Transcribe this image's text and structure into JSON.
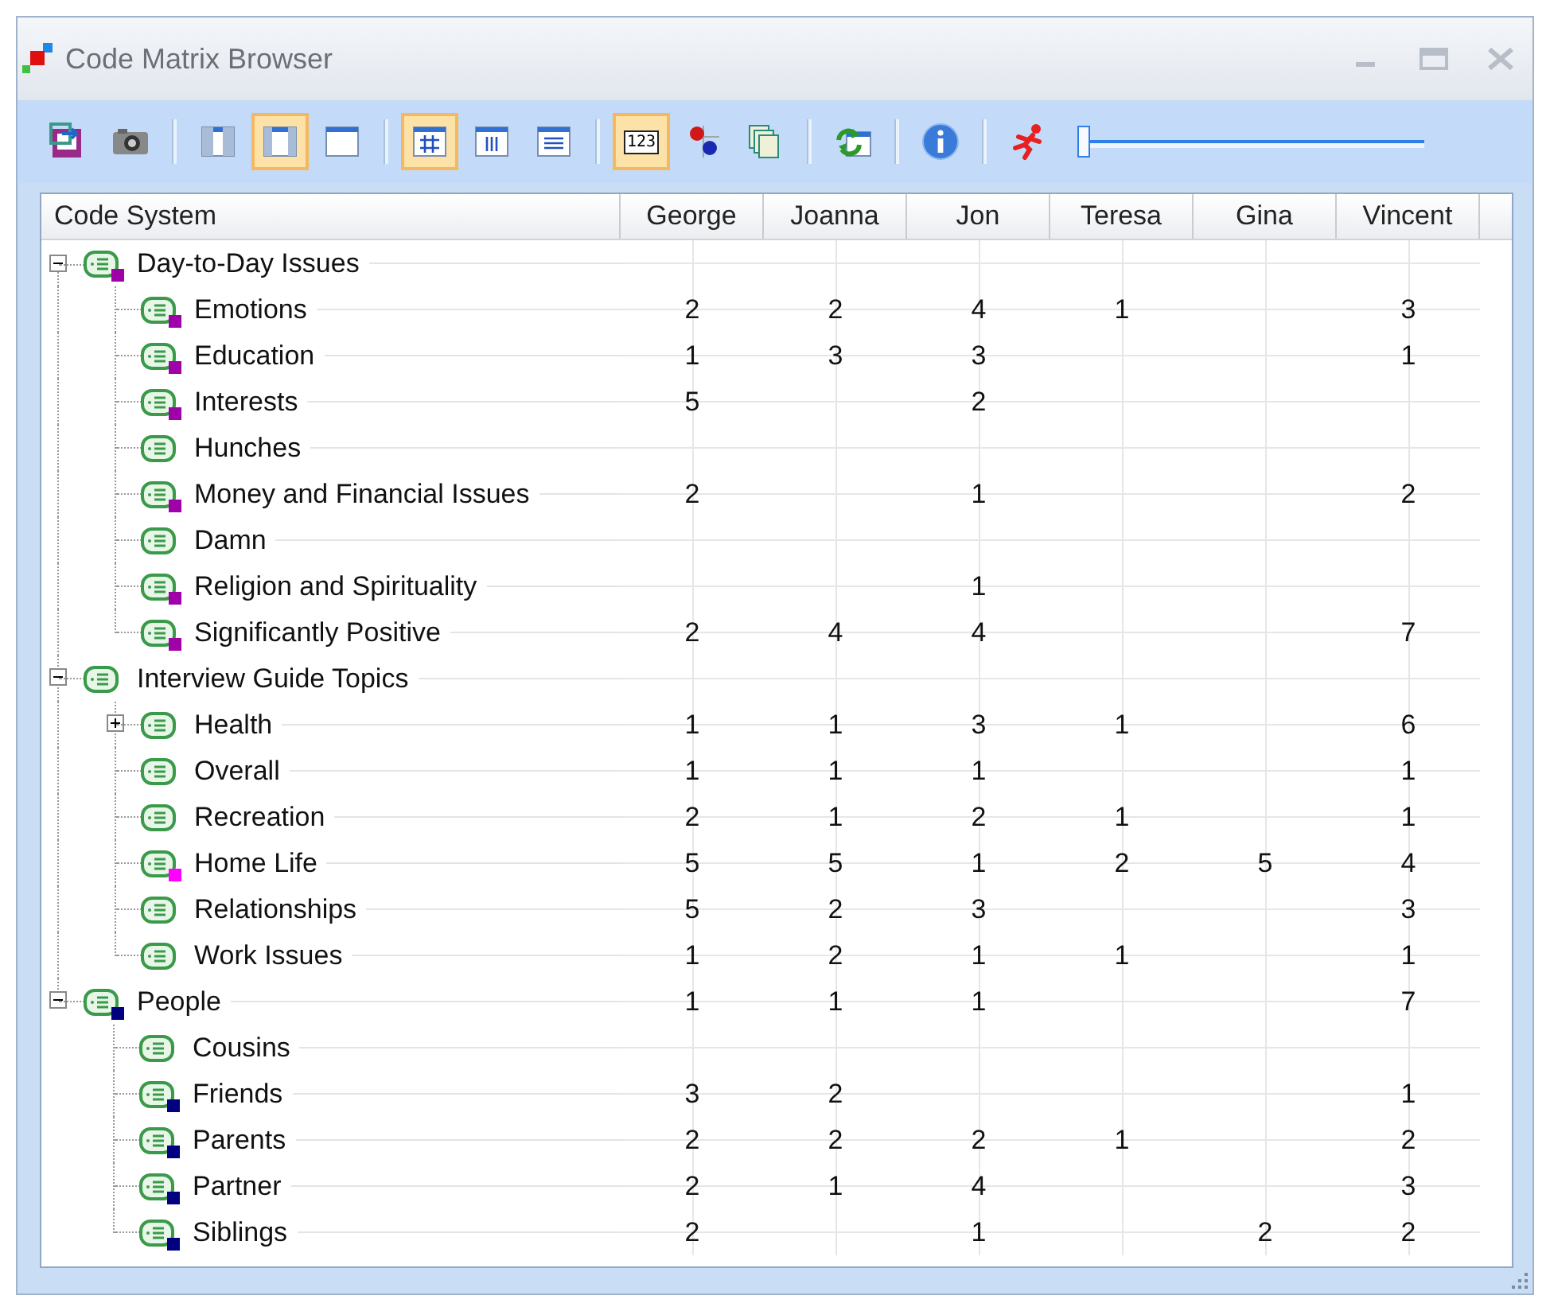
{
  "window": {
    "title": "Code Matrix Browser"
  },
  "toolbar": [
    {
      "kind": "export",
      "selected": false
    },
    {
      "kind": "camera",
      "selected": false
    },
    {
      "kind": "sep"
    },
    {
      "kind": "layout-left",
      "selected": false
    },
    {
      "kind": "layout-mid",
      "selected": true
    },
    {
      "kind": "layout-full",
      "selected": false
    },
    {
      "kind": "sep"
    },
    {
      "kind": "grid",
      "selected": true
    },
    {
      "kind": "cols",
      "selected": false
    },
    {
      "kind": "rows",
      "selected": false
    },
    {
      "kind": "sep"
    },
    {
      "kind": "numbers",
      "selected": true,
      "label": "123"
    },
    {
      "kind": "nodes",
      "selected": false
    },
    {
      "kind": "copy",
      "selected": false
    },
    {
      "kind": "sep"
    },
    {
      "kind": "refresh",
      "selected": false
    },
    {
      "kind": "sep"
    },
    {
      "kind": "info",
      "selected": false
    },
    {
      "kind": "sep"
    },
    {
      "kind": "run",
      "selected": false
    }
  ],
  "slider": {
    "level": 0
  },
  "table": {
    "tree_header": "Code System",
    "columns": [
      "George",
      "Joanna",
      "Jon",
      "Teresa",
      "Gina",
      "Vincent"
    ],
    "rows": [
      {
        "name": "Day-to-Day Issues",
        "color": "#a000a8",
        "expanded": true,
        "cells": [
          null,
          null,
          null,
          null,
          null,
          null
        ],
        "children": [
          {
            "name": "Emotions",
            "color": "#a000a8",
            "cells": [
              "2",
              "2",
              "4",
              "1",
              null,
              "3"
            ]
          },
          {
            "name": "Education",
            "color": "#a000a8",
            "cells": [
              "1",
              "3",
              "3",
              null,
              null,
              "1"
            ]
          },
          {
            "name": "Interests",
            "color": "#a000a8",
            "cells": [
              "5",
              null,
              "2",
              null,
              null,
              null
            ]
          },
          {
            "name": "Hunches",
            "cells": [
              null,
              null,
              null,
              null,
              null,
              null
            ]
          },
          {
            "name": "Money and Financial Issues",
            "color": "#a000a8",
            "cells": [
              "2",
              null,
              "1",
              null,
              null,
              "2"
            ]
          },
          {
            "name": "Damn",
            "cells": [
              null,
              null,
              null,
              null,
              null,
              null
            ]
          },
          {
            "name": "Religion and Spirituality",
            "color": "#a000a8",
            "cells": [
              null,
              null,
              "1",
              null,
              null,
              null
            ]
          },
          {
            "name": "Significantly Positive",
            "color": "#a000a8",
            "cells": [
              "2",
              "4",
              "4",
              null,
              null,
              "7"
            ]
          }
        ]
      },
      {
        "name": "Interview Guide Topics",
        "expanded": true,
        "cells": [
          null,
          null,
          null,
          null,
          null,
          null
        ],
        "children": [
          {
            "name": "Health",
            "expanded": false,
            "cells": [
              "1",
              "1",
              "3",
              "1",
              null,
              "6"
            ]
          },
          {
            "name": "Overall",
            "cells": [
              "1",
              "1",
              "1",
              null,
              null,
              "1"
            ]
          },
          {
            "name": "Recreation",
            "cells": [
              "2",
              "1",
              "2",
              "1",
              null,
              "1"
            ]
          },
          {
            "name": "Home Life",
            "color": "#ff00ff",
            "cells": [
              "5",
              "5",
              "1",
              "2",
              "5",
              "4"
            ]
          },
          {
            "name": "Relationships",
            "cells": [
              "5",
              "2",
              "3",
              null,
              null,
              "3"
            ]
          },
          {
            "name": "Work Issues",
            "cells": [
              "1",
              "2",
              "1",
              "1",
              null,
              "1"
            ]
          }
        ]
      },
      {
        "name": "People",
        "color": "#000080",
        "expanded": true,
        "cells": [
          "1",
          "1",
          "1",
          null,
          null,
          "7"
        ],
        "children": [
          {
            "name": "Cousins",
            "cells": [
              null,
              null,
              null,
              null,
              null,
              null
            ]
          },
          {
            "name": "Friends",
            "color": "#000080",
            "cells": [
              "3",
              "2",
              null,
              null,
              null,
              "1"
            ]
          },
          {
            "name": "Parents",
            "color": "#000080",
            "cells": [
              "2",
              "2",
              "2",
              "1",
              null,
              "2"
            ]
          },
          {
            "name": "Partner",
            "color": "#000080",
            "cells": [
              "2",
              "1",
              "4",
              null,
              null,
              "3"
            ]
          },
          {
            "name": "Siblings",
            "color": "#000080",
            "cells": [
              "2",
              null,
              "1",
              null,
              "2",
              "2"
            ]
          }
        ]
      }
    ]
  }
}
